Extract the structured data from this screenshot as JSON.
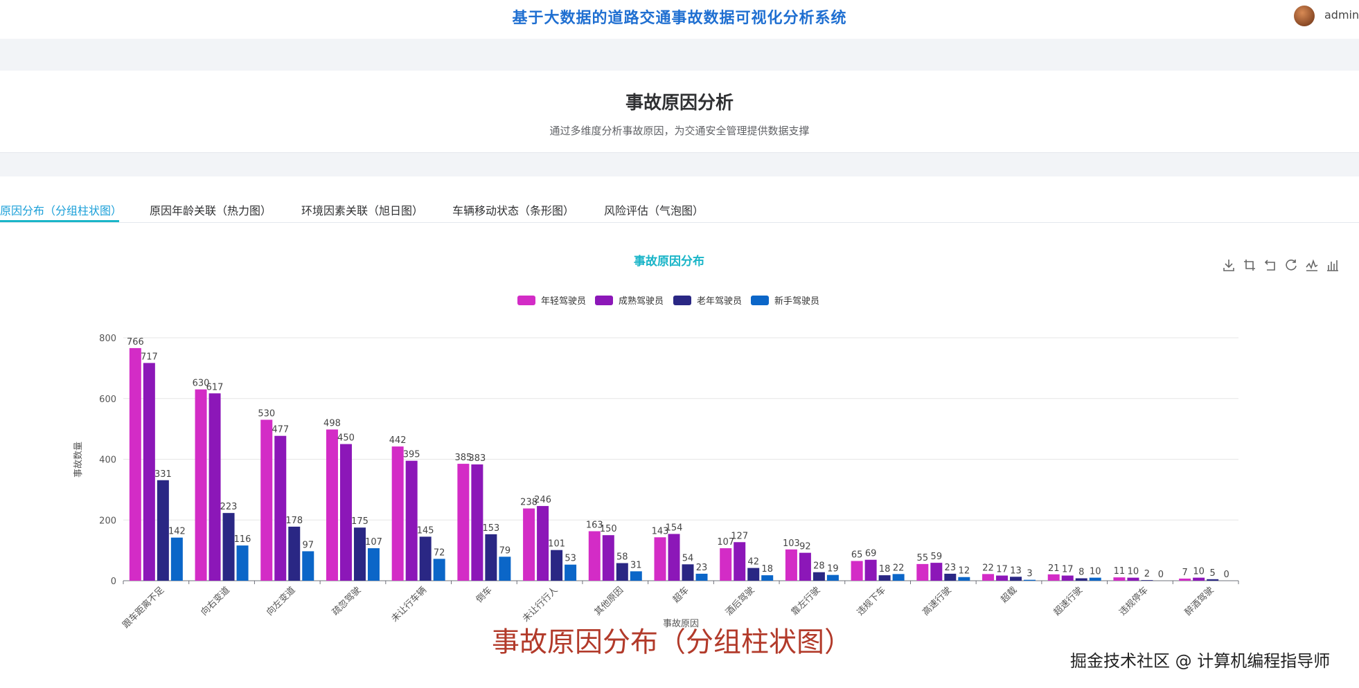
{
  "header": {
    "system_title": "基于大数据的道路交通事故数据可视化分析系统",
    "username": "admin"
  },
  "page": {
    "title": "事故原因分析",
    "subtitle": "通过多维度分析事故原因，为交通安全管理提供数据支撑"
  },
  "tabs": [
    {
      "label": "原因分布（分组柱状图）",
      "active": true
    },
    {
      "label": "原因年龄关联（热力图）",
      "active": false
    },
    {
      "label": "环境因素关联（旭日图）",
      "active": false
    },
    {
      "label": "车辆移动状态（条形图）",
      "active": false
    },
    {
      "label": "风险评估（气泡图）",
      "active": false
    }
  ],
  "toolbox": [
    "download-icon",
    "zoom-icon",
    "zoom-reset-icon",
    "restore-icon",
    "line-switch-icon",
    "bar-switch-icon"
  ],
  "caption": "事故原因分布（分组柱状图）",
  "watermark": "掘金技术社区 @ 计算机编程指导师",
  "colors": {
    "accent": "#1a9fd8",
    "title": "#1f6fd1",
    "caption": "#b23a2a"
  },
  "chart_data": {
    "type": "bar",
    "title": "事故原因分布",
    "xlabel": "事故原因",
    "ylabel": "事故数量",
    "ylim": [
      0,
      800
    ],
    "yticks": [
      0,
      200,
      400,
      600,
      800
    ],
    "legend_position": "top-center",
    "grid": true,
    "categories": [
      "跟车距离不足",
      "向右变道",
      "向左变道",
      "疏忽驾驶",
      "未让行车辆",
      "倒车",
      "未让行行人",
      "其他原因",
      "超车",
      "酒后驾驶",
      "靠左行驶",
      "违规下车",
      "高速行驶",
      "超载",
      "超速行驶",
      "违规停车",
      "醉酒驾驶"
    ],
    "series": [
      {
        "name": "年轻驾驶员",
        "color": "#d32cc6",
        "values": [
          766,
          630,
          530,
          498,
          442,
          385,
          238,
          163,
          143,
          107,
          103,
          65,
          55,
          22,
          21,
          11,
          7
        ]
      },
      {
        "name": "成熟驾驶员",
        "color": "#8c17b8",
        "values": [
          717,
          617,
          477,
          450,
          395,
          383,
          246,
          150,
          154,
          127,
          92,
          69,
          59,
          17,
          17,
          10,
          10
        ]
      },
      {
        "name": "老年驾驶员",
        "color": "#2a2784",
        "values": [
          331,
          223,
          178,
          175,
          145,
          153,
          101,
          58,
          54,
          42,
          28,
          18,
          23,
          13,
          8,
          2,
          5
        ]
      },
      {
        "name": "新手驾驶员",
        "color": "#0b66c8",
        "values": [
          142,
          116,
          97,
          107,
          72,
          79,
          53,
          31,
          23,
          18,
          19,
          22,
          12,
          3,
          10,
          0,
          0
        ]
      }
    ]
  }
}
